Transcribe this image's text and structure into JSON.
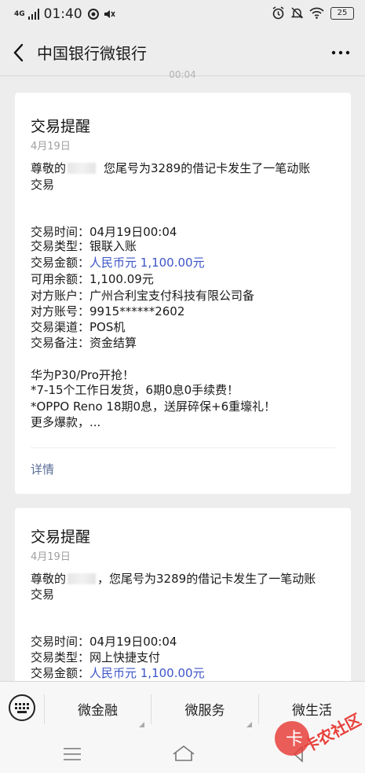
{
  "status_bar": {
    "network": "4G",
    "time": "01:40",
    "battery": "25"
  },
  "nav": {
    "title": "中国银行微银行"
  },
  "time_separator": "00:04",
  "cards": [
    {
      "title": "交易提醒",
      "date": "4月19日",
      "greeting_prefix": "尊敬的",
      "greeting_suffix": "您尾号为3289的借记卡发生了一笔动账",
      "greeting_line2": "交易",
      "fields": [
        {
          "label": "交易时间：",
          "value": "04月19日00:04"
        },
        {
          "label": "交易类型：",
          "value": "银联入账"
        },
        {
          "label": "交易金额：",
          "value": "人民币元 1,100.00元"
        },
        {
          "label": "可用余额：",
          "value": "1,100.09元"
        },
        {
          "label": "对方账户：",
          "value": "广州合利宝支付科技有限公司备"
        },
        {
          "label": "对方账号：",
          "value": "9915******2602"
        },
        {
          "label": "交易渠道：",
          "value": "POS机"
        },
        {
          "label": "交易备注：",
          "value": "资金结算"
        }
      ],
      "promo": [
        "华为P30/Pro开抢！",
        "*7-15个工作日发货，6期0息0手续费！",
        "*OPPO Reno 18期0息，送屏碎保+6重壕礼！",
        "更多爆款，..."
      ],
      "detail_label": "详情"
    },
    {
      "title": "交易提醒",
      "date": "4月19日",
      "greeting_prefix": "尊敬的",
      "greeting_suffix": "，您尾号为3289的借记卡发生了一笔动账",
      "greeting_line2": "交易",
      "fields": [
        {
          "label": "交易时间：",
          "value": "04月19日00:04"
        },
        {
          "label": "交易类型：",
          "value": "网上快捷支付"
        },
        {
          "label": "交易金额：",
          "value": "人民币元 1,100.00元"
        }
      ]
    }
  ],
  "bottom_menu": {
    "items": [
      "微金融",
      "微服务",
      "微生活"
    ]
  },
  "watermark": {
    "text": "卡农社区"
  },
  "colors": {
    "background": "#ededed",
    "card": "#ffffff",
    "amount_blue": "#3c55c8",
    "link": "#576b95"
  }
}
